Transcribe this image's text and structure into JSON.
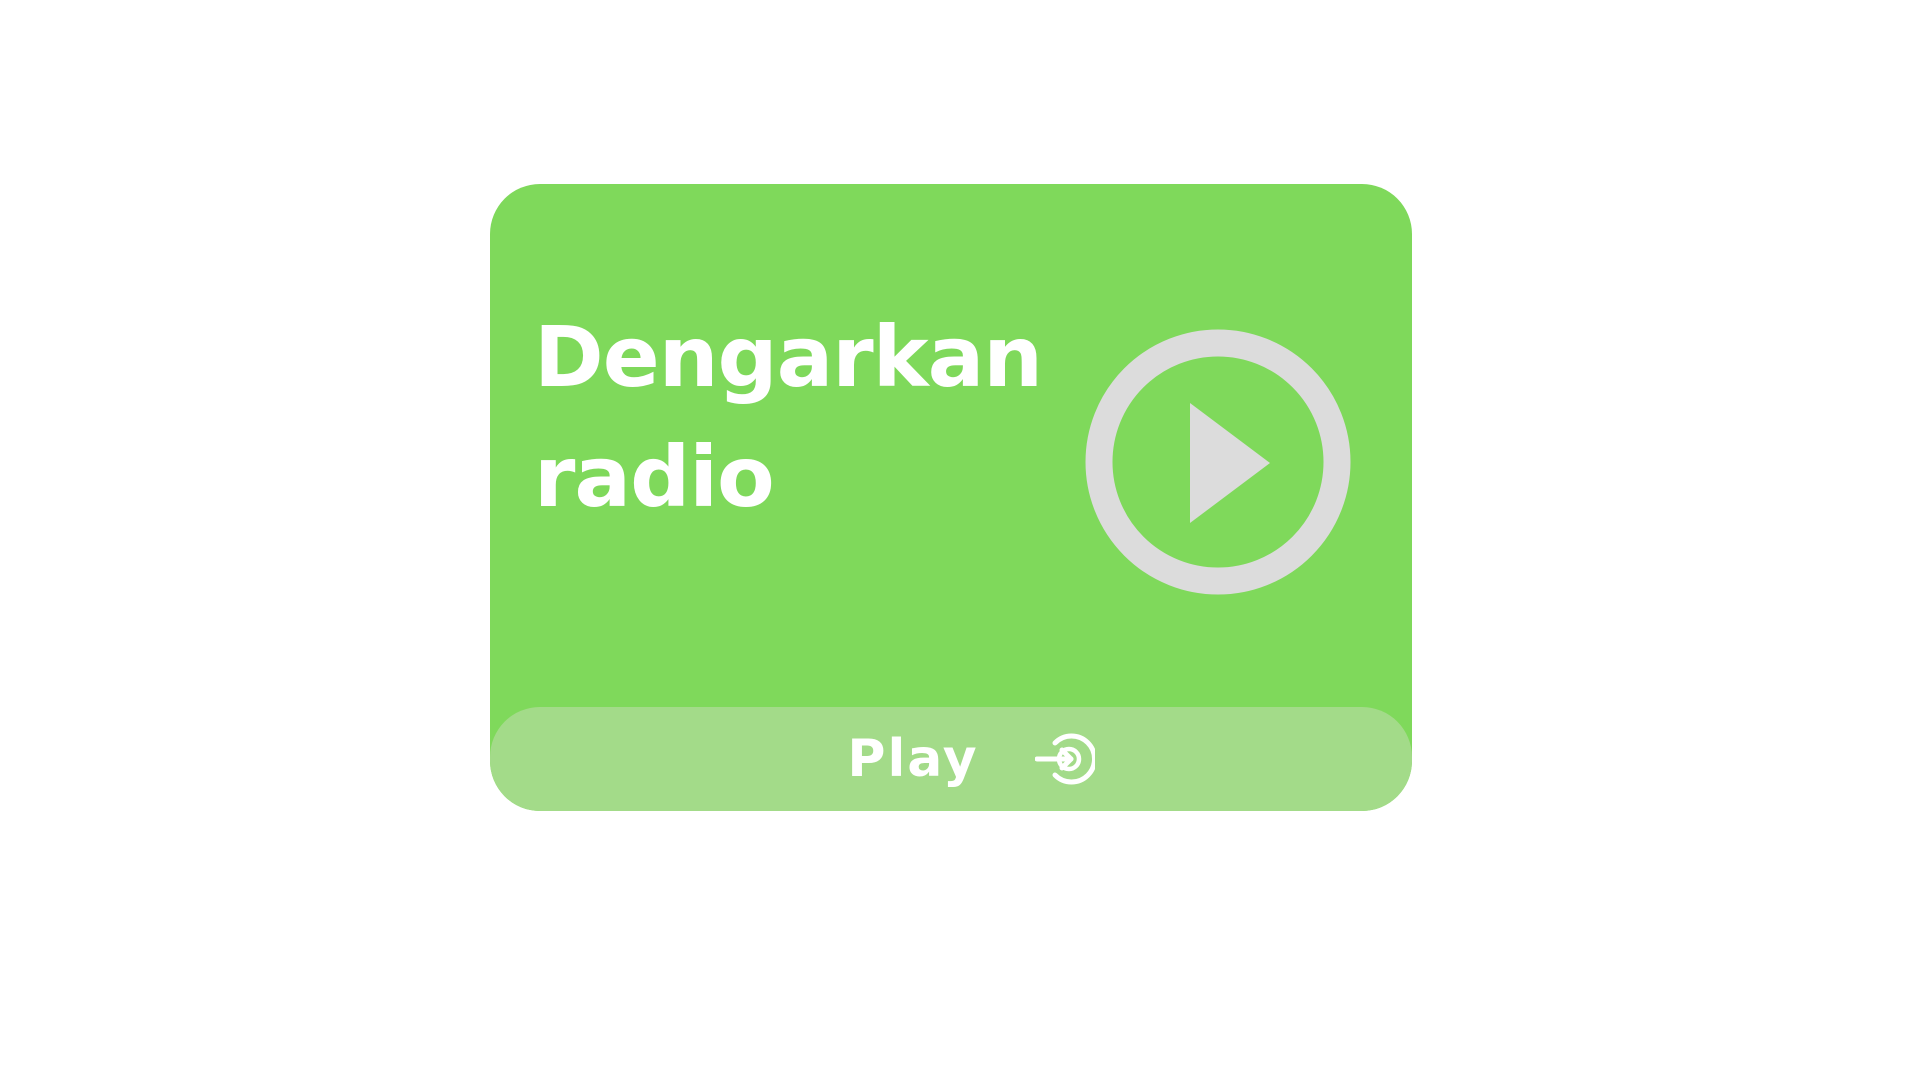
{
  "card": {
    "title_line1": "Dengarkan",
    "title_line2": "radio",
    "play_icon": "play-circle-icon",
    "footer_label": "Play",
    "footer_icon": "enter-circle-icon"
  },
  "colors": {
    "card_background": "#7fd95b",
    "footer_background": "#a3db89",
    "icon_color": "#dcdcdc",
    "text_color": "#ffffff",
    "page_background": "#ffffff"
  }
}
